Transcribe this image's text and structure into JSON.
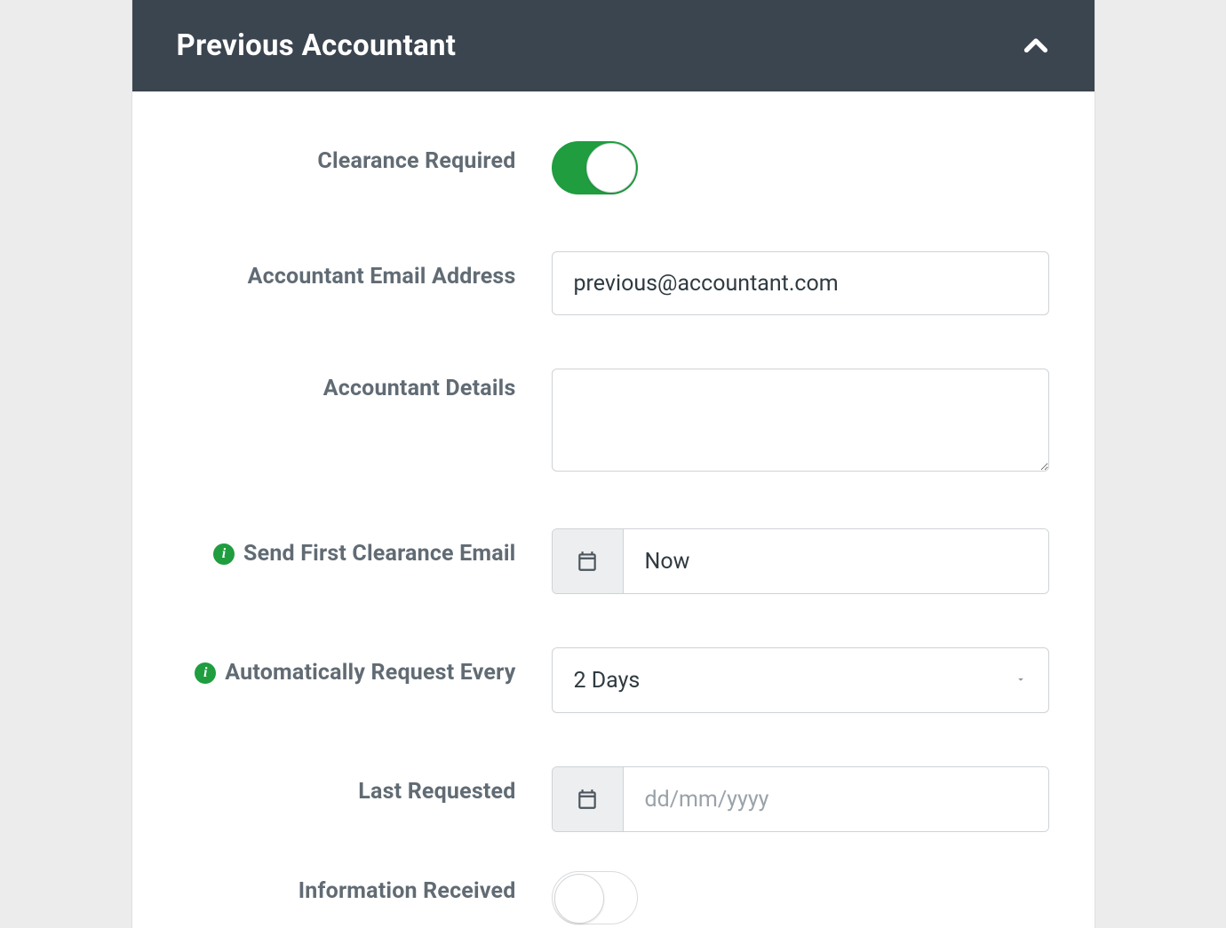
{
  "panel": {
    "title": "Previous Accountant"
  },
  "fields": {
    "clearance_required": {
      "label": "Clearance Required",
      "value": true
    },
    "email": {
      "label": "Accountant Email Address",
      "value": "previous@accountant.com"
    },
    "details": {
      "label": "Accountant Details",
      "value": ""
    },
    "first_email": {
      "label": "Send First Clearance Email",
      "value": "Now"
    },
    "auto_req": {
      "label": "Automatically Request Every",
      "value": "2 Days"
    },
    "last_req": {
      "label": "Last Requested",
      "value": "",
      "placeholder": "dd/mm/yyyy"
    },
    "info_recv": {
      "label": "Information Received",
      "value": false
    }
  }
}
